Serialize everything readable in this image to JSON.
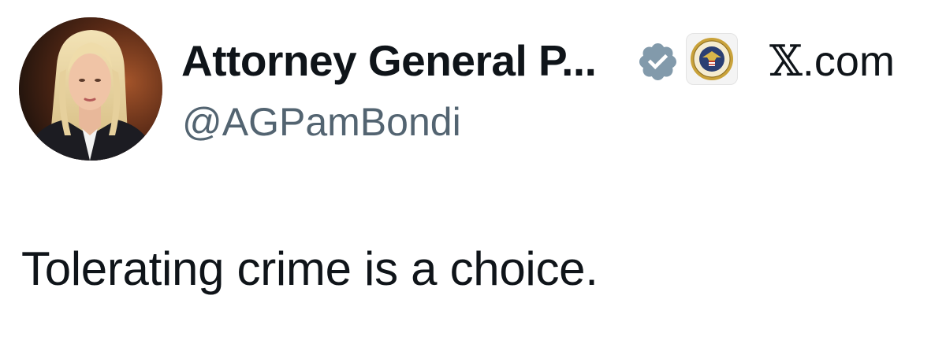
{
  "author": {
    "display_name": "Attorney General P...",
    "handle": "@AGPamBondi",
    "verified_icon": "verified-badge-icon",
    "affiliate_icon": "department-of-justice-seal-icon",
    "avatar_icon": "profile-photo"
  },
  "source": {
    "x_glyph": "𝕏",
    "domain": ".com"
  },
  "post": {
    "text": "Tolerating crime is a choice."
  },
  "colors": {
    "text_primary": "#0f1419",
    "text_secondary": "#536471",
    "verified_badge": "#829aab",
    "background": "#ffffff"
  }
}
